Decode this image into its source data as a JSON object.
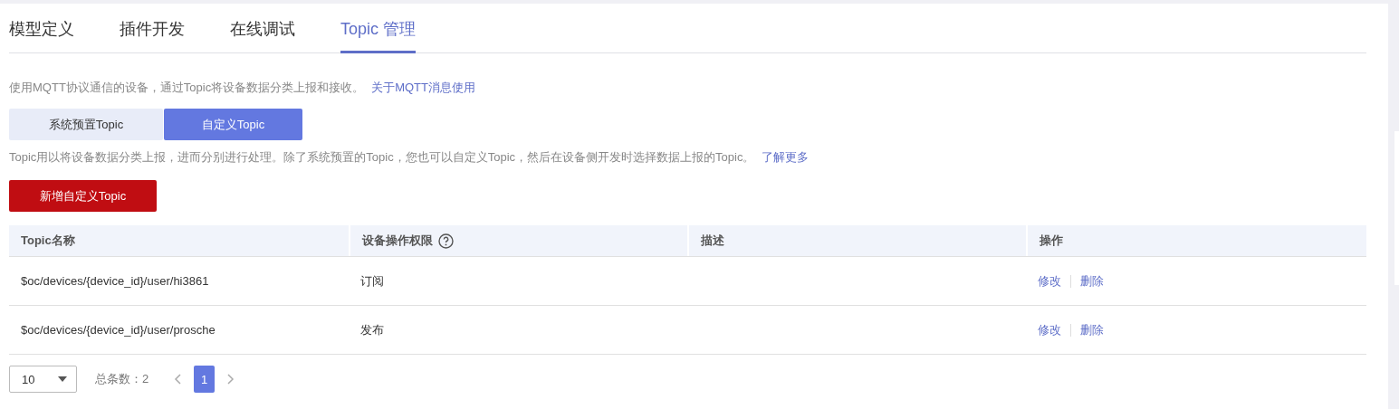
{
  "tabs": [
    {
      "label": "模型定义",
      "selected": false
    },
    {
      "label": "插件开发",
      "selected": false
    },
    {
      "label": "在线调试",
      "selected": false
    },
    {
      "label": "Topic 管理",
      "selected": true
    }
  ],
  "intro": {
    "text": "使用MQTT协议通信的设备，通过Topic将设备数据分类上报和接收。",
    "link": "关于MQTT消息使用"
  },
  "segments": [
    {
      "label": "系统预置Topic",
      "selected": false
    },
    {
      "label": "自定义Topic",
      "selected": true
    }
  ],
  "description": {
    "text": "Topic用以将设备数据分类上报，进而分别进行处理。除了系统预置的Topic，您也可以自定义Topic，然后在设备侧开发时选择数据上报的Topic。",
    "link": "了解更多"
  },
  "add_button": "新增自定义Topic",
  "table": {
    "columns": [
      {
        "label": "Topic名称",
        "help": false
      },
      {
        "label": "设备操作权限",
        "help": true
      },
      {
        "label": "描述",
        "help": false
      },
      {
        "label": "操作",
        "help": false
      }
    ],
    "rows": [
      {
        "name": "$oc/devices/{device_id}/user/hi3861",
        "permission": "订阅",
        "actions": [
          "修改",
          "删除"
        ]
      },
      {
        "name": "$oc/devices/{device_id}/user/prosche",
        "permission": "发布",
        "actions": [
          "修改",
          "删除"
        ]
      }
    ]
  },
  "pagination": {
    "page_size": "10",
    "total": "总条数：2",
    "pages": [
      {
        "label": "1",
        "selected": true
      }
    ]
  }
}
